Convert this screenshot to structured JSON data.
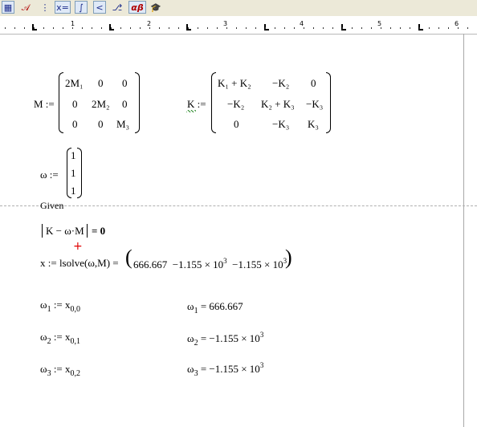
{
  "toolbar": {
    "buttons": [
      {
        "icon": "calculator-icon",
        "glyph": "▦"
      },
      {
        "icon": "graph-toolbar-icon",
        "glyph": "𝒜"
      },
      {
        "icon": "matrix-toolbar-icon",
        "glyph": "⋮"
      },
      {
        "icon": "evaluation-toolbar-icon",
        "glyph": "x="
      },
      {
        "icon": "calculus-toolbar-icon",
        "glyph": "∫"
      },
      {
        "icon": "boolean-toolbar-icon",
        "glyph": "<"
      },
      {
        "icon": "programming-toolbar-icon",
        "glyph": "⎇"
      },
      {
        "icon": "greek-toolbar-icon",
        "glyph": "αβ"
      },
      {
        "icon": "symbolic-toolbar-icon",
        "glyph": "🎓"
      }
    ]
  },
  "ruler": {
    "numbers": [
      "1",
      "2",
      "3",
      "4",
      "5",
      "6"
    ]
  },
  "worksheet": {
    "M_def": {
      "lhs": "M :=",
      "rows": [
        [
          "2M₁",
          "0",
          "0"
        ],
        [
          "0",
          "2M₂",
          "0"
        ],
        [
          "0",
          "0",
          "M₃"
        ]
      ]
    },
    "K_def": {
      "lhs_name": "K",
      "assign": ":=",
      "rows": [
        [
          "K₁ + K₂",
          "−K₂",
          "0"
        ],
        [
          "−K₂",
          "K₂ + K₃",
          "−K₃"
        ],
        [
          "0",
          "−K₃",
          "K₃"
        ]
      ]
    },
    "omega_def": {
      "lhs": "ω :=",
      "values": [
        "1",
        "1",
        "1"
      ]
    },
    "given": "Given",
    "constraint": {
      "inner": "K − ω·M",
      "rhs": "= 0"
    },
    "cursor": "+",
    "solve": {
      "lhs": "x := lsolve(ω,M) =",
      "v1": "666.667",
      "v2": "−1.155 × 10",
      "v2_exp": "3",
      "v3": "−1.155 × 10",
      "v3_exp": "3"
    },
    "defs": [
      {
        "lhs": "ω",
        "sub": "1",
        "op": ":=",
        "rhs": "x",
        "rhs_sub": "0,0"
      },
      {
        "lhs": "ω",
        "sub": "2",
        "op": ":=",
        "rhs": "x",
        "rhs_sub": "0,1"
      },
      {
        "lhs": "ω",
        "sub": "3",
        "op": ":=",
        "rhs": "x",
        "rhs_sub": "0,2"
      }
    ],
    "results": [
      {
        "lhs": "ω",
        "sub": "1",
        "value": "= 666.667",
        "exp": ""
      },
      {
        "lhs": "ω",
        "sub": "2",
        "value": "= −1.155 × 10",
        "exp": "3"
      },
      {
        "lhs": "ω",
        "sub": "3",
        "value": "= −1.155 × 10",
        "exp": "3"
      }
    ]
  }
}
